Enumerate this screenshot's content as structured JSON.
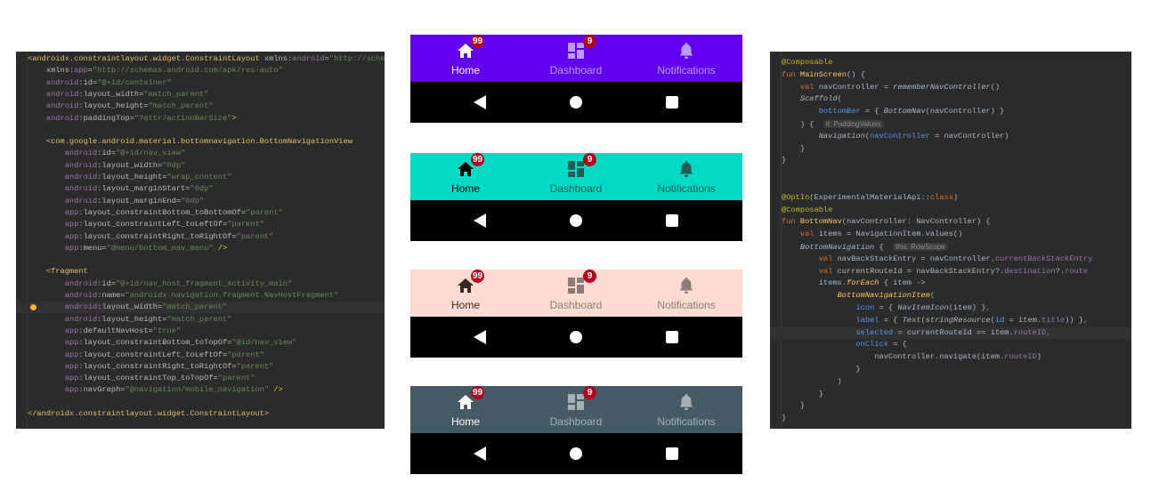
{
  "xml_editor": {
    "lines": [
      [
        [
          "t",
          "<androidx.constraintlayout.widget.ConstraintLayout "
        ],
        [
          "a",
          "xmlns:"
        ],
        [
          "n",
          "android"
        ],
        [
          "a",
          "="
        ],
        [
          "s",
          "\"http://schema"
        ]
      ],
      [
        [
          "p",
          "    "
        ],
        [
          "a",
          "xmlns:"
        ],
        [
          "n",
          "app"
        ],
        [
          "a",
          "="
        ],
        [
          "s",
          "\"http://schemas.android.com/apk/res-auto\""
        ]
      ],
      [
        [
          "p",
          "    "
        ],
        [
          "n",
          "android"
        ],
        [
          "a",
          ":id="
        ],
        [
          "s",
          "\"@+id/container\""
        ]
      ],
      [
        [
          "p",
          "    "
        ],
        [
          "n",
          "android"
        ],
        [
          "a",
          ":layout_width="
        ],
        [
          "s",
          "\"match_parent\""
        ]
      ],
      [
        [
          "p",
          "    "
        ],
        [
          "n",
          "android"
        ],
        [
          "a",
          ":layout_height="
        ],
        [
          "s",
          "\"match_parent\""
        ]
      ],
      [
        [
          "p",
          "    "
        ],
        [
          "n",
          "android"
        ],
        [
          "a",
          ":paddingTop="
        ],
        [
          "s",
          "\"?attr/actionBarSize\""
        ],
        [
          "t",
          ">"
        ]
      ],
      [],
      [
        [
          "p",
          "    "
        ],
        [
          "t",
          "<com.google.android.material.bottomnavigation.BottomNavigationView"
        ]
      ],
      [
        [
          "p",
          "        "
        ],
        [
          "n",
          "android"
        ],
        [
          "a",
          ":id="
        ],
        [
          "s",
          "\"@+id/nav_view\""
        ]
      ],
      [
        [
          "p",
          "        "
        ],
        [
          "n",
          "android"
        ],
        [
          "a",
          ":layout_width="
        ],
        [
          "s",
          "\"0dp\""
        ]
      ],
      [
        [
          "p",
          "        "
        ],
        [
          "n",
          "android"
        ],
        [
          "a",
          ":layout_height="
        ],
        [
          "s",
          "\"wrap_content\""
        ]
      ],
      [
        [
          "p",
          "        "
        ],
        [
          "n",
          "android"
        ],
        [
          "a",
          ":layout_marginStart="
        ],
        [
          "s",
          "\"0dp\""
        ]
      ],
      [
        [
          "p",
          "        "
        ],
        [
          "n",
          "android"
        ],
        [
          "a",
          ":layout_marginEnd="
        ],
        [
          "s",
          "\"0dp\""
        ]
      ],
      [
        [
          "p",
          "        "
        ],
        [
          "n",
          "app"
        ],
        [
          "a",
          ":layout_constraintBottom_toBottomOf="
        ],
        [
          "s",
          "\"parent\""
        ]
      ],
      [
        [
          "p",
          "        "
        ],
        [
          "n",
          "app"
        ],
        [
          "a",
          ":layout_constraintLeft_toLeftOf="
        ],
        [
          "s",
          "\"parent\""
        ]
      ],
      [
        [
          "p",
          "        "
        ],
        [
          "n",
          "app"
        ],
        [
          "a",
          ":layout_constraintRight_toRightOf="
        ],
        [
          "s",
          "\"parent\""
        ]
      ],
      [
        [
          "p",
          "        "
        ],
        [
          "n",
          "app"
        ],
        [
          "a",
          ":menu="
        ],
        [
          "s",
          "\"@menu/bottom_nav_menu\""
        ],
        [
          "t",
          " />"
        ]
      ],
      [],
      [
        [
          "p",
          "    "
        ],
        [
          "t",
          "<fragment"
        ]
      ],
      [
        [
          "p",
          "        "
        ],
        [
          "n",
          "android"
        ],
        [
          "a",
          ":id="
        ],
        [
          "s",
          "\"@+id/nav_host_fragment_activity_main\""
        ]
      ],
      [
        [
          "p",
          "        "
        ],
        [
          "n",
          "android"
        ],
        [
          "a",
          ":name="
        ],
        [
          "s",
          "\"androidx.navigation.fragment.NavHostFragment\""
        ]
      ],
      [
        [
          "p",
          "        "
        ],
        [
          "n",
          "android"
        ],
        [
          "a",
          ":layout_width="
        ],
        [
          "s",
          "\"match_parent\""
        ]
      ],
      [
        [
          "p",
          "        "
        ],
        [
          "n",
          "android"
        ],
        [
          "a",
          ":layout_height="
        ],
        [
          "s",
          "\"match_parent\""
        ]
      ],
      [
        [
          "p",
          "        "
        ],
        [
          "n",
          "app"
        ],
        [
          "a",
          ":defaultNavHost="
        ],
        [
          "s",
          "\"true\""
        ]
      ],
      [
        [
          "p",
          "        "
        ],
        [
          "n",
          "app"
        ],
        [
          "a",
          ":layout_constraintBottom_toTopOf="
        ],
        [
          "s",
          "\"@id/nav_view\""
        ]
      ],
      [
        [
          "p",
          "        "
        ],
        [
          "n",
          "app"
        ],
        [
          "a",
          ":layout_constraintLeft_toLeftOf="
        ],
        [
          "s",
          "\"parent\""
        ]
      ],
      [
        [
          "p",
          "        "
        ],
        [
          "n",
          "app"
        ],
        [
          "a",
          ":layout_constraintRight_toRightOf="
        ],
        [
          "s",
          "\"parent\""
        ]
      ],
      [
        [
          "p",
          "        "
        ],
        [
          "n",
          "app"
        ],
        [
          "a",
          ":layout_constraintTop_toTopOf="
        ],
        [
          "s",
          "\"parent\""
        ]
      ],
      [
        [
          "p",
          "        "
        ],
        [
          "n",
          "app"
        ],
        [
          "a",
          ":navGraph="
        ],
        [
          "s",
          "\"@navigation/mobile_navigation\""
        ],
        [
          "t",
          " />"
        ]
      ],
      [],
      [
        [
          "t",
          "</androidx.constraintlayout.widget.ConstraintLayout>"
        ]
      ]
    ],
    "highlighted_line": 21
  },
  "kotlin_editor": {
    "lines": [
      [
        [
          "o",
          "@Composable"
        ]
      ],
      [
        [
          "k",
          "fun "
        ],
        [
          "f",
          "MainScreen"
        ],
        [
          "p",
          "() {"
        ]
      ],
      [
        [
          "p",
          "    "
        ],
        [
          "k",
          "val "
        ],
        [
          "p",
          "navController = "
        ],
        [
          "i",
          "rememberNavController"
        ],
        [
          "p",
          "()"
        ]
      ],
      [
        [
          "p",
          "    "
        ],
        [
          "i",
          "Scaffold"
        ],
        [
          "p",
          "("
        ]
      ],
      [
        [
          "p",
          "        "
        ],
        [
          "b",
          "bottomBar"
        ],
        [
          "p",
          " = { "
        ],
        [
          "i",
          "BottomNav"
        ],
        [
          "p",
          "(navController) }"
        ]
      ],
      [
        [
          "p",
          "    ) {  "
        ],
        [
          "h",
          "it: PaddingValues"
        ]
      ],
      [
        [
          "p",
          "        "
        ],
        [
          "i",
          "Navigation"
        ],
        [
          "p",
          "("
        ],
        [
          "b",
          "navController"
        ],
        [
          "p",
          " = navController)"
        ]
      ],
      [
        [
          "p",
          "    }"
        ]
      ],
      [
        [
          "p",
          "}"
        ]
      ],
      [],
      [],
      [
        [
          "o",
          "@OptIn"
        ],
        [
          "p",
          "(ExperimentalMaterialApi::"
        ],
        [
          "k",
          "class"
        ],
        [
          "p",
          ")"
        ]
      ],
      [
        [
          "o",
          "@Composable"
        ]
      ],
      [
        [
          "k",
          "fun "
        ],
        [
          "f",
          "BottomNav"
        ],
        [
          "p",
          "(navController: NavController) {"
        ]
      ],
      [
        [
          "p",
          "    "
        ],
        [
          "k",
          "val "
        ],
        [
          "p",
          "items = NavigationItem.values()"
        ]
      ],
      [
        [
          "p",
          "    "
        ],
        [
          "i",
          "BottomNavigation"
        ],
        [
          "p",
          " {  "
        ],
        [
          "h",
          "this: RowScope"
        ]
      ],
      [
        [
          "p",
          "        "
        ],
        [
          "k",
          "val "
        ],
        [
          "p",
          "navBackStackEntry = navController."
        ],
        [
          "v",
          "currentBackStackEntry"
        ]
      ],
      [
        [
          "p",
          "        "
        ],
        [
          "k",
          "val "
        ],
        [
          "p",
          "currentRouteId = navBackStackEntry?."
        ],
        [
          "v",
          "destination"
        ],
        [
          "p",
          "?."
        ],
        [
          "v",
          "route"
        ]
      ],
      [
        [
          "p",
          "        items."
        ],
        [
          "y",
          "forEach"
        ],
        [
          "p",
          " { item ->"
        ]
      ],
      [
        [
          "p",
          "            "
        ],
        [
          "y",
          "BottomNavigationItem"
        ],
        [
          "p",
          "("
        ]
      ],
      [
        [
          "p",
          "                "
        ],
        [
          "b",
          "icon"
        ],
        [
          "p",
          " = { "
        ],
        [
          "i",
          "NavItemIcon"
        ],
        [
          "p",
          "(item) }"
        ],
        [
          "k",
          ","
        ]
      ],
      [
        [
          "p",
          "                "
        ],
        [
          "b",
          "label"
        ],
        [
          "p",
          " = { "
        ],
        [
          "i",
          "Text"
        ],
        [
          "p",
          "("
        ],
        [
          "i",
          "stringResource"
        ],
        [
          "p",
          "("
        ],
        [
          "b",
          "id"
        ],
        [
          "p",
          " = item."
        ],
        [
          "v",
          "title"
        ],
        [
          "p",
          ")) }"
        ],
        [
          "k",
          ","
        ]
      ],
      [
        [
          "p",
          "                "
        ],
        [
          "b",
          "selected"
        ],
        [
          "p",
          " = currentRouteId == item."
        ],
        [
          "v",
          "routeID"
        ],
        [
          "k",
          ","
        ]
      ],
      [
        [
          "p",
          "                "
        ],
        [
          "b",
          "onClick"
        ],
        [
          "p",
          " = {"
        ]
      ],
      [
        [
          "p",
          "                    navController.navigate(item."
        ],
        [
          "v",
          "routeID"
        ],
        [
          "p",
          ")"
        ]
      ],
      [
        [
          "p",
          "                }"
        ]
      ],
      [
        [
          "p",
          "            )"
        ]
      ],
      [
        [
          "p",
          "        }"
        ]
      ],
      [
        [
          "p",
          "    }"
        ]
      ],
      [
        [
          "p",
          "}"
        ]
      ]
    ],
    "highlighted_line": 22
  },
  "bottom_nav": {
    "items": [
      {
        "label": "Home",
        "icon": "home-icon",
        "badge": "99",
        "selected": true
      },
      {
        "label": "Dashboard",
        "icon": "dashboard-icon",
        "badge": "9",
        "selected": false
      },
      {
        "label": "Notifications",
        "icon": "bell-icon",
        "badge": "",
        "selected": false
      }
    ],
    "system_bar": [
      "back-icon",
      "home-circle-icon",
      "recents-icon"
    ],
    "themes": [
      {
        "bg": "#6200ee",
        "selected": "#ffffff",
        "unselected": "#b99cf7"
      },
      {
        "bg": "#03dac5",
        "selected": "#000000",
        "unselected": "#1f5e58"
      },
      {
        "bg": "#fcdcd2",
        "selected": "#3e2723",
        "unselected": "#8d7b77"
      },
      {
        "bg": "#455a64",
        "selected": "#ffffff",
        "unselected": "#a6b1b6"
      }
    ],
    "badge_color": "#b3001e"
  }
}
